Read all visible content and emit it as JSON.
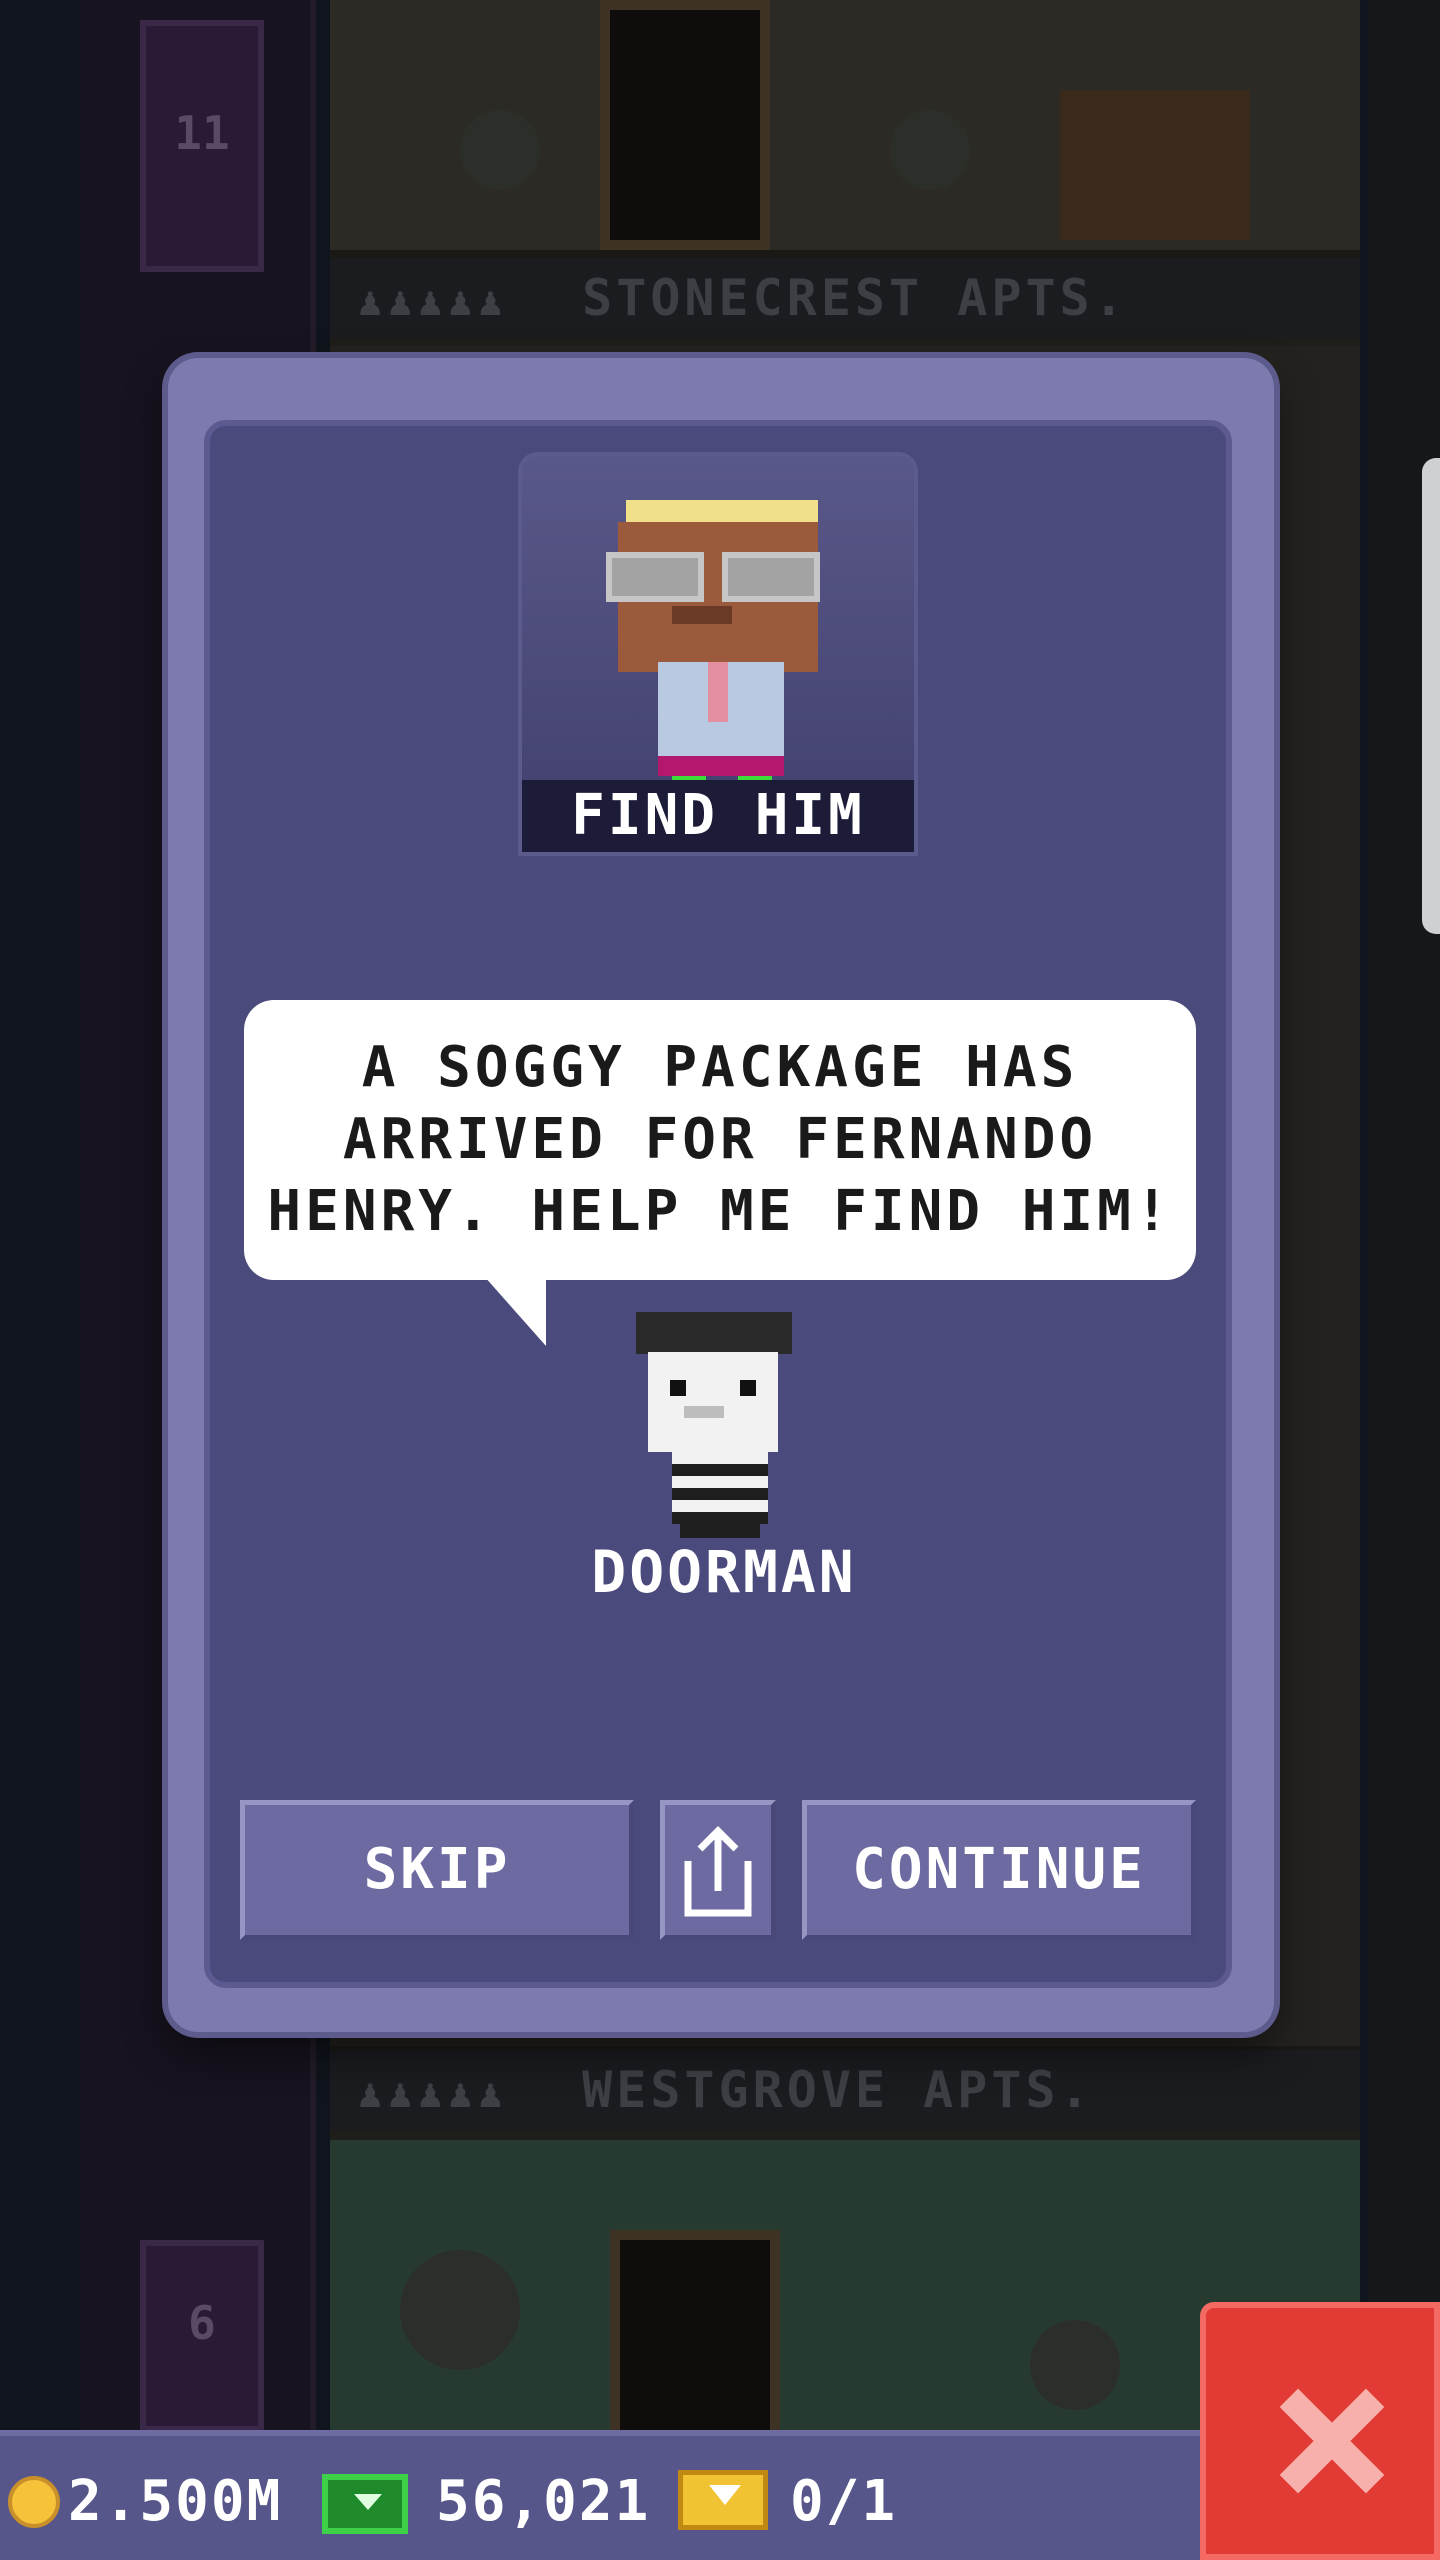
{
  "background": {
    "floors": [
      {
        "elevator_number": "11",
        "sign": "STONECREST APTS.",
        "people_icons": "♟♟♟♟♟"
      },
      {
        "elevator_number": "6",
        "sign": "WESTGROVE APTS.",
        "people_icons": "♟♟♟♟♟"
      }
    ]
  },
  "dialog": {
    "portrait_caption": "FIND HIM",
    "speech": "A SOGGY PACKAGE HAS ARRIVED FOR FERNANDO HENRY. HELP ME FIND HIM!",
    "speaker": "DOORMAN",
    "buttons": {
      "skip": "SKIP",
      "continue": "CONTINUE"
    }
  },
  "status_bar": {
    "coins": "2.500M",
    "bux": "56,021",
    "tickets": "0/1"
  },
  "colors": {
    "dialog_frame": "#7d7ab0",
    "dialog_body": "#4b4a7c",
    "close_button": "#e23a34"
  },
  "icons": {
    "share": "share-icon",
    "close": "close-icon",
    "coin": "coin-icon",
    "bux": "bux-icon",
    "ticket": "ticket-icon"
  }
}
